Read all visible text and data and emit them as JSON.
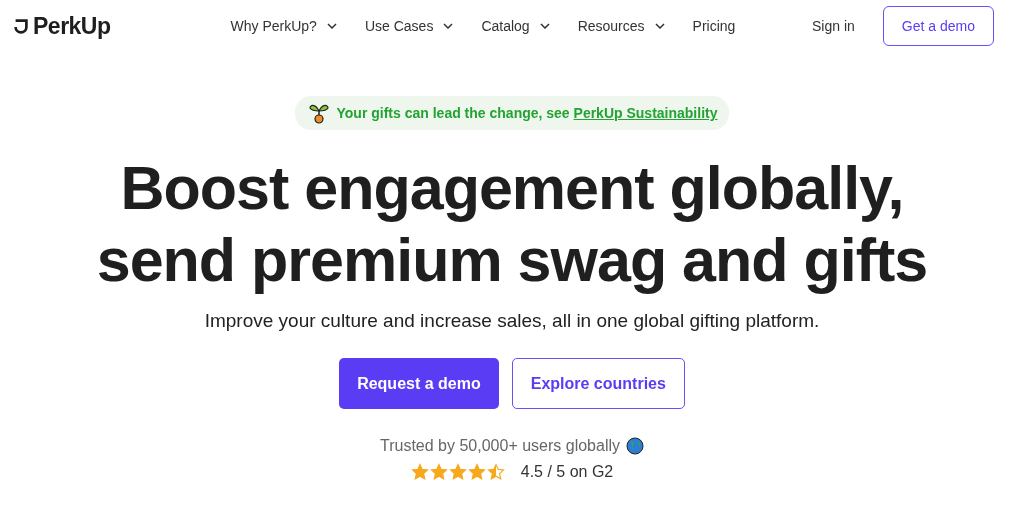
{
  "header": {
    "logo": "PerkUp",
    "nav": [
      {
        "label": "Why PerkUp?",
        "dropdown": true
      },
      {
        "label": "Use Cases",
        "dropdown": true
      },
      {
        "label": "Catalog",
        "dropdown": true
      },
      {
        "label": "Resources",
        "dropdown": true
      },
      {
        "label": "Pricing",
        "dropdown": false
      }
    ],
    "sign_in": "Sign in",
    "demo_button": "Get a demo"
  },
  "banner": {
    "text": "Your gifts can lead the change, see ",
    "link": "PerkUp Sustainability"
  },
  "headline": [
    "Boost engagement globally,",
    "send premium swag and gifts"
  ],
  "subtitle": "Improve your culture and increase sales, all in one global gifting platform.",
  "buttons": [
    {
      "label": "Request a demo",
      "kind": "primary"
    },
    {
      "label": "Explore countries",
      "kind": "outline"
    }
  ],
  "trust": "Trusted by 50,000+ users globally",
  "rating": {
    "stars": 4.5,
    "text": "4.5 / 5 on G2"
  }
}
